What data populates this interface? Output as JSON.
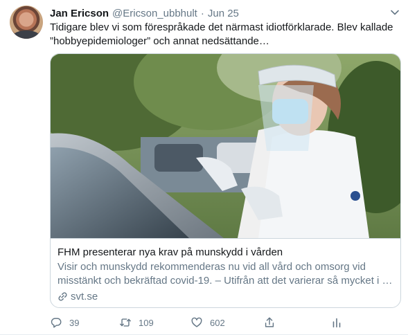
{
  "tweet": {
    "author_name": "Jan Ericson",
    "handle": "@Ericson_ubbhult",
    "separator": "·",
    "date": "Jun 25",
    "text": "Tidigare blev vi som förespråkade det närmast idiotförklarade. Blev kallade ”hobbyepidemiologer” och annat nedsättande…"
  },
  "card": {
    "title": "FHM presenterar nya krav på munskydd i vården",
    "description": "Visir och munskydd rekommenderas nu vid all vård och omsorg vid misstänkt och bekräftad covid-19. – Utifrån att det varierar så mycket i …",
    "domain": "svt.se"
  },
  "actions": {
    "replies": "39",
    "retweets": "109",
    "likes": "602"
  },
  "colors": {
    "text": "#14171a",
    "secondary": "#657786",
    "border": "#ccd6dd"
  },
  "icons": [
    "caret-down-icon",
    "link-icon",
    "reply-icon",
    "retweet-icon",
    "like-icon",
    "share-icon",
    "analytics-icon"
  ]
}
